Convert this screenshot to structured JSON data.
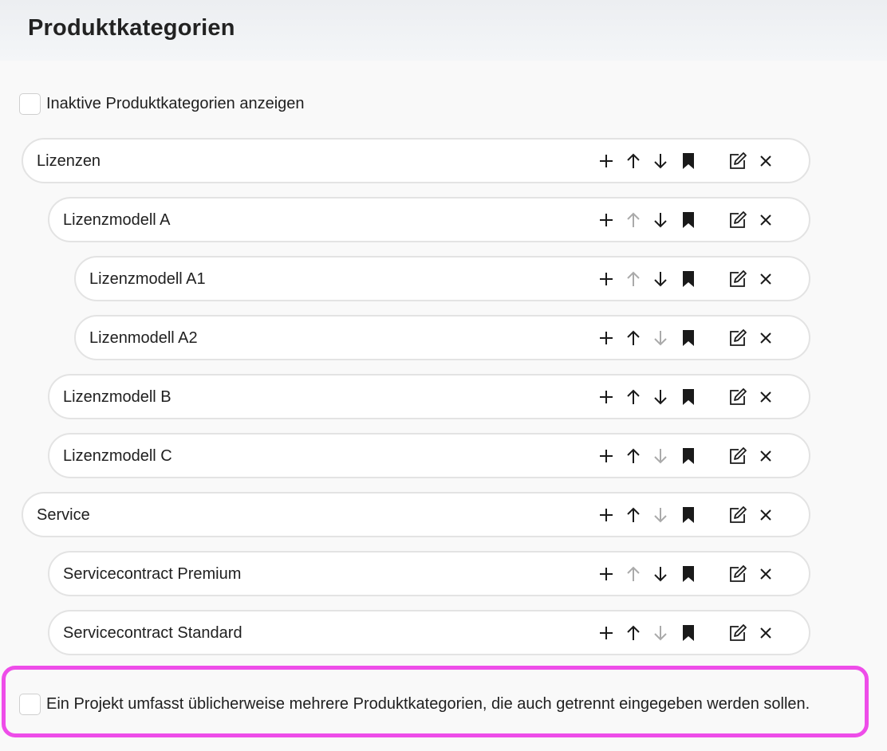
{
  "header": {
    "title": "Produktkategorien"
  },
  "options": {
    "show_inactive_label": "Inaktive Produktkategorien anzeigen",
    "multi_category_label": "Ein Projekt umfasst üblicherweise mehrere Produktkategorien, die auch getrennt eingegeben werden sollen."
  },
  "colors": {
    "icon_active": "#1a1a1a",
    "icon_disabled": "#aaaaaa",
    "highlight": "#ee4de9"
  },
  "categories": [
    {
      "label": "Lizenzen",
      "level": 0,
      "up_enabled": true,
      "down_enabled": true
    },
    {
      "label": "Lizenzmodell A",
      "level": 1,
      "up_enabled": false,
      "down_enabled": true
    },
    {
      "label": "Lizenzmodell A1",
      "level": 2,
      "up_enabled": false,
      "down_enabled": true
    },
    {
      "label": "Lizenmodell A2",
      "level": 2,
      "up_enabled": true,
      "down_enabled": false
    },
    {
      "label": "Lizenzmodell B",
      "level": 1,
      "up_enabled": true,
      "down_enabled": true
    },
    {
      "label": "Lizenzmodell C",
      "level": 1,
      "up_enabled": true,
      "down_enabled": false
    },
    {
      "label": "Service",
      "level": 0,
      "up_enabled": true,
      "down_enabled": false
    },
    {
      "label": "Servicecontract Premium",
      "level": 1,
      "up_enabled": false,
      "down_enabled": true
    },
    {
      "label": "Servicecontract Standard",
      "level": 1,
      "up_enabled": true,
      "down_enabled": false
    }
  ],
  "row_actions": [
    {
      "name": "add",
      "icon": "plus-icon"
    },
    {
      "name": "move-up",
      "icon": "arrow-up-icon"
    },
    {
      "name": "move-down",
      "icon": "arrow-down-icon"
    },
    {
      "name": "bookmark",
      "icon": "bookmark-icon"
    },
    {
      "name": "edit",
      "icon": "edit-icon"
    },
    {
      "name": "delete",
      "icon": "close-icon"
    }
  ]
}
